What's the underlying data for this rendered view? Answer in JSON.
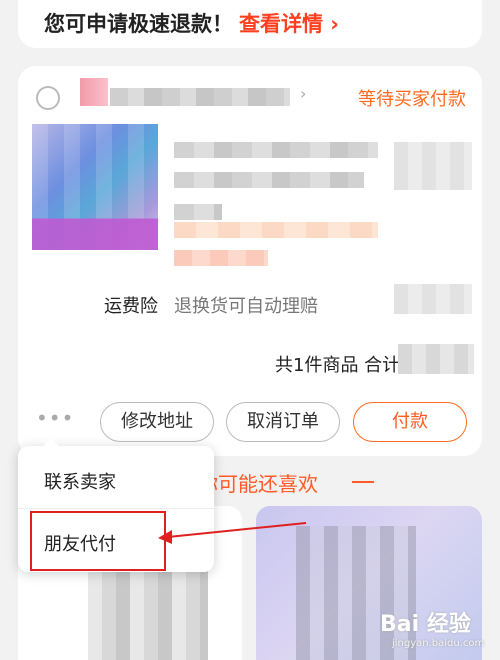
{
  "banner": {
    "refund_text": "您可申请极速退款！",
    "refund_link": "查看详情 ›",
    "close_icon": "close-icon"
  },
  "order": {
    "status": "等待买家付款",
    "chevron": "›",
    "insurance_label": "运费险",
    "insurance_desc": "退换货可自动理赔",
    "total_text": "共1件商品  合计: ¥",
    "more_label": "•••",
    "buttons": {
      "modify_address": "修改地址",
      "cancel_order": "取消订单",
      "pay": "付款"
    }
  },
  "popup_menu": {
    "items": [
      "联系卖家",
      "朋友代付"
    ]
  },
  "recommend": {
    "title": "你可能还喜欢"
  },
  "watermark": {
    "logo_text": "Bai 经验",
    "url": "jingyan.baidu.com"
  },
  "colors": {
    "accent": "#ff6a1f",
    "highlight": "#e02020",
    "background": "#f2f2f2"
  }
}
